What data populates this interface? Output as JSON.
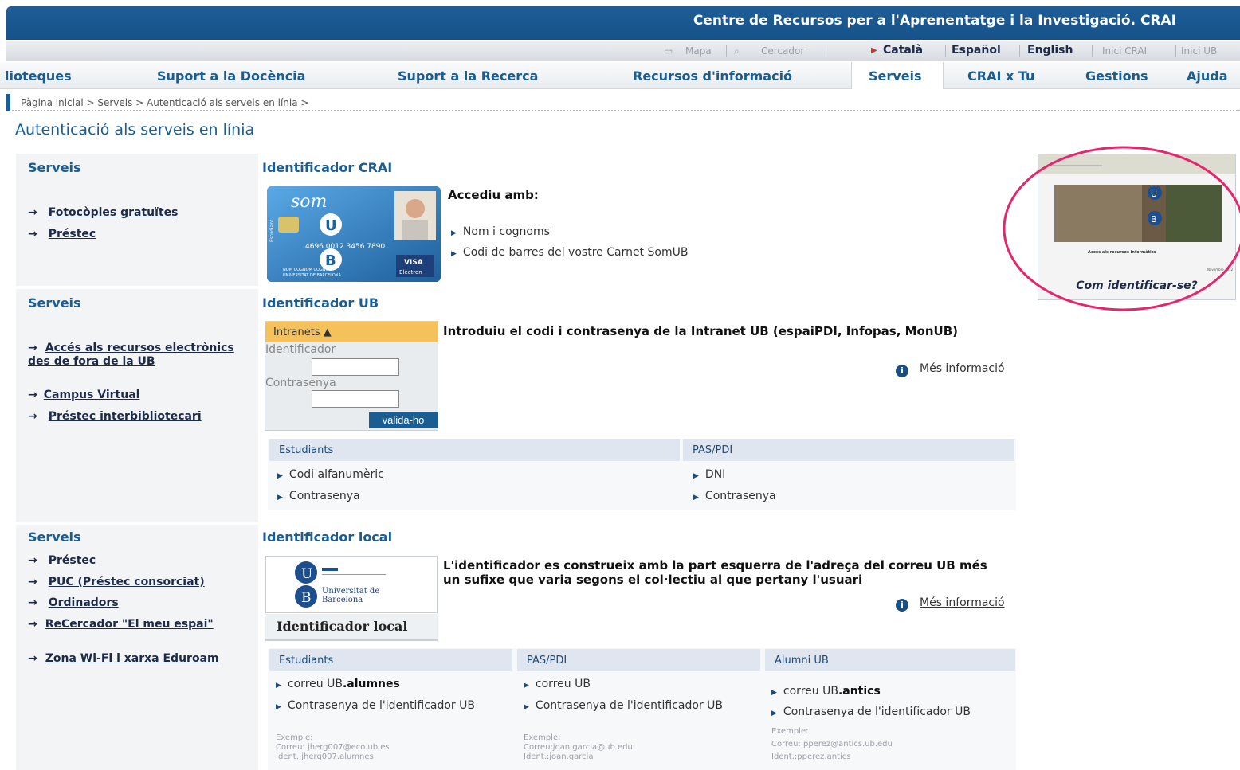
{
  "header": {
    "title": "Centre de Recursos per a l'Aprenentatge i la Investigació. CRAI"
  },
  "util": {
    "map": "Mapa",
    "search": "Cercador",
    "lang_ca": "Català",
    "lang_es": "Español",
    "lang_en": "English",
    "home_crai": "Inici CRAI",
    "home_ub": "Inici UB"
  },
  "nav": {
    "items": [
      "lioteques",
      "Suport a la Docència",
      "Suport a la Recerca",
      "Recursos d'informació",
      "Serveis",
      "CRAI x Tu",
      "Gestions",
      "Ajuda"
    ],
    "active": "Serveis"
  },
  "breadcrumb": "Pàgina inicial > Serveis  > Autenticació als serveis en línia >",
  "page_title": "Autenticació als serveis en línia",
  "section1": {
    "side_title": "Serveis",
    "side_links": [
      "Fotocòpies gratuïtes",
      "Préstec"
    ],
    "title": "Identificador CRAI",
    "access": "Accediu amb:",
    "bullets": [
      "Nom i cognoms",
      "Codi de barres del vostre Carnet SomUB"
    ],
    "card": {
      "brand": "som",
      "number": "4696 0012 3456 7890",
      "visa": "VISA",
      "electron": "Electron",
      "name": "NOM COGNOM COGNOM",
      "uni": "UNIVERSITAT DE BARCELONA",
      "side": "Estudiant"
    }
  },
  "section2": {
    "side_title": "Serveis",
    "side_links": [
      "Accés als recursos electrònics des de fora de la UB",
      "Campus Virtual",
      "Préstec interbibliotecari"
    ],
    "title": "Identificador UB",
    "desc": "Introduiu el codi i contrasenya de la Intranet UB (espaiPDI, Infopas, MonUB)",
    "login": {
      "header": "Intranets ▲",
      "user_label": "Identificador",
      "pass_label": "Contrasenya",
      "button": "valida-ho"
    },
    "more": "Més informació",
    "table": {
      "col1": "Estudiants",
      "col2": "PAS/PDI",
      "c1": [
        "Codi alfanumèric",
        "Contrasenya"
      ],
      "c2": [
        "DNI",
        "Contrasenya"
      ]
    }
  },
  "section3": {
    "side_title": "Serveis",
    "side_links": [
      "Préstec",
      "PUC (Préstec consorciat)",
      "Ordinadors",
      "ReCercador \"El meu espai\"",
      "Zona Wi-Fi i xarxa Eduroam"
    ],
    "title": "Identificador local",
    "logo_name": "Universitat de Barcelona",
    "logo_caption": "Identificador local",
    "desc": "L'identificador es construeix amb la part esquerra de l'adreça del correu UB més un sufixe que varia segons el col·lectiu al que pertany l'usuari",
    "more": "Més informació",
    "table": {
      "col1": "Estudiants",
      "col2": "PAS/PDI",
      "col3": "Alumni UB",
      "c1_mail": "correu UB",
      "c1_suffix": ".alumnes",
      "c1_pass": "Contrasenya de l'identificador UB",
      "c1_ex": "Exemple:",
      "c1_ex_mail": "Correu: jherg007@eco.ub.es",
      "c1_ex_id": "Ident.:jherg007.alumnes",
      "c2_mail": "correu UB",
      "c2_pass": "Contrasenya de l'identificador UB",
      "c2_ex": "Exemple:",
      "c2_ex_mail": "Correu:joan.garcia@ub.edu",
      "c2_ex_id": "Ident.:joan.garcia",
      "c3_mail": "correu UB",
      "c3_suffix": ".antics",
      "c3_pass": "Contrasenya de l'identificador UB",
      "c3_ex": "Exemple:",
      "c3_ex_mail": "Correu: pperez@antics.ub.edu",
      "c3_ex_id": "Ident.:pperez.antics"
    }
  },
  "promo": {
    "caption": "Com identificar-se?",
    "thumb_title": "Accés als recursos informàtics",
    "thumb_date": "Novembre 2012"
  },
  "colors": {
    "brand": "#1a5d93",
    "highlight": "#e5266e"
  }
}
